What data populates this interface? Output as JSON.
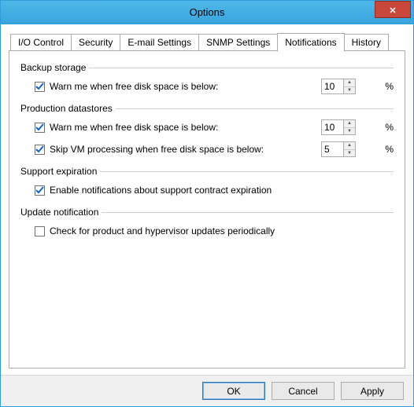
{
  "window": {
    "title": "Options"
  },
  "tabs": {
    "io": "I/O Control",
    "security": "Security",
    "email": "E-mail Settings",
    "snmp": "SNMP Settings",
    "notifications": "Notifications",
    "history": "History"
  },
  "groups": {
    "backup_storage": {
      "title": "Backup storage",
      "warn": {
        "checked": true,
        "label": "Warn me when free disk space is below:",
        "value": "10",
        "unit": "%"
      }
    },
    "production_datastores": {
      "title": "Production datastores",
      "warn": {
        "checked": true,
        "label": "Warn me when free disk space is below:",
        "value": "10",
        "unit": "%"
      },
      "skip": {
        "checked": true,
        "label": "Skip VM processing when free disk space is below:",
        "value": "5",
        "unit": "%"
      }
    },
    "support_expiration": {
      "title": "Support expiration",
      "enable": {
        "checked": true,
        "label": "Enable notifications about support contract expiration"
      }
    },
    "update_notification": {
      "title": "Update notification",
      "check": {
        "checked": false,
        "label": "Check for product and hypervisor updates periodically"
      }
    }
  },
  "buttons": {
    "ok": "OK",
    "cancel": "Cancel",
    "apply": "Apply"
  },
  "glyphs": {
    "up": "▲",
    "down": "▼"
  }
}
